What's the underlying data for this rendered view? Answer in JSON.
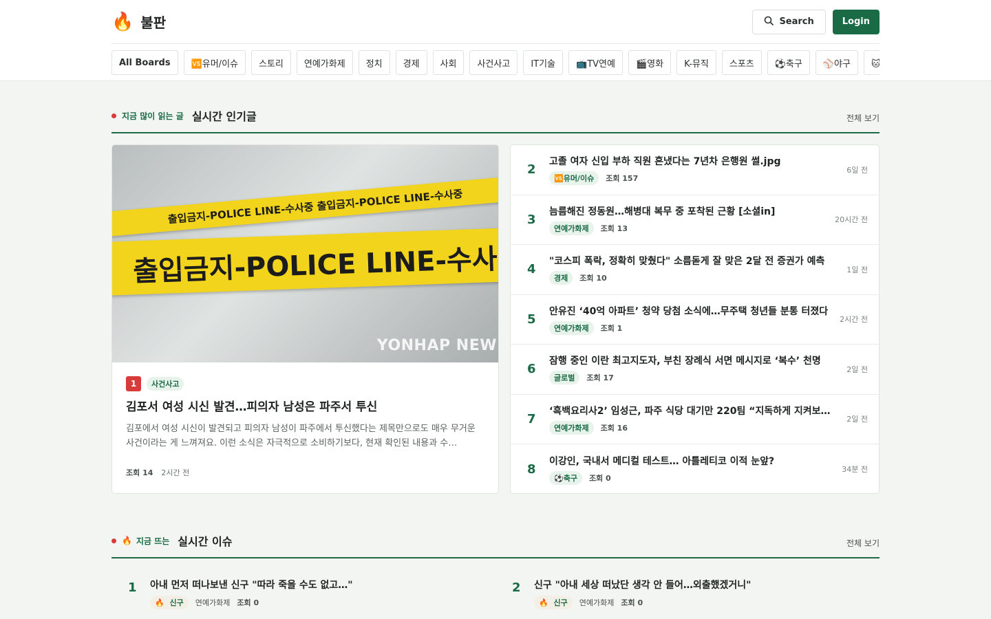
{
  "site": {
    "logo_icon": "🔥",
    "name": "불판"
  },
  "header": {
    "search_label": "Search",
    "login_label": "Login"
  },
  "boards": [
    "All Boards",
    "🆚유머/이슈",
    "스토리",
    "연예가화제",
    "정치",
    "경제",
    "사회",
    "사건사고",
    "IT기술",
    "📺TV연예",
    "🎬영화",
    "K-뮤직",
    "스포츠",
    "⚽축구",
    "⚾야구",
    "🐱반려"
  ],
  "hot": {
    "eyebrow": "지금 많이 읽는 글",
    "title": "실시간 인기글",
    "more": "전체 보기",
    "feature": {
      "rank": "1",
      "category": "사건사고",
      "title": "김포서 여성 시신 발견…피의자 남성은 파주서 투신",
      "excerpt": "김포에서 여성 시신이 발견되고 피의자 남성이 파주에서 투신했다는 제목만으로도 매우 무거운 사건이라는 게 느껴져요. 이런 소식은 자극적으로 소비하기보다, 현재 확인된 내용과 수…",
      "views": "조회 14",
      "time": "2시간 전",
      "image_text": {
        "tape_small": "출입금지-POLICE LINE-수사중   출입금지-POLICE LINE-수사중",
        "tape_large": "출입금지-POLICE LINE-수사",
        "watermark": "YONHAP NEW"
      }
    },
    "items": [
      {
        "rank": "2",
        "title": "고졸 여자 신입 부하 직원 혼냈다는 7년차 은행원 썰.jpg",
        "category": "🆚유머/이슈",
        "views": "조회 157",
        "time": "6일 전"
      },
      {
        "rank": "3",
        "title": "늠름해진 정동원…해병대 복무 중 포착된 근황 [소셜in]",
        "category": "연예가화제",
        "views": "조회 13",
        "time": "20시간 전"
      },
      {
        "rank": "4",
        "title": "\"코스피 폭락, 정확히 맞췄다\" 소름돋게 잘 맞은 2달 전 증권가 예측",
        "category": "경제",
        "views": "조회 10",
        "time": "1일 전"
      },
      {
        "rank": "5",
        "title": "안유진 ‘40억 아파트’ 청약 당첨 소식에…무주택 청년들 분통 터졌다",
        "category": "연예가화제",
        "views": "조회 1",
        "time": "2시간 전"
      },
      {
        "rank": "6",
        "title": "잠행 중인 이란 최고지도자, 부친 장례식 서면 메시지로 ‘복수’ 천명",
        "category": "글로벌",
        "views": "조회 17",
        "time": "2일 전"
      },
      {
        "rank": "7",
        "title": "‘흑백요리사2’ 임성근, 파주 식당 대기만 220팀 “지독하게 지켜보겠다”",
        "category": "연예가화제",
        "views": "조회 16",
        "time": "2일 전"
      },
      {
        "rank": "8",
        "title": "이강인, 국내서 메디컬 테스트… 아틀레티코 이적 눈앞?",
        "category": "⚽축구",
        "views": "조회 0",
        "time": "34분 전"
      }
    ]
  },
  "issues": {
    "eyebrow": "지금 뜨는",
    "eyebrow_icon": "🔥",
    "title": "실시간 이슈",
    "more": "전체 보기",
    "items": [
      {
        "rank": "1",
        "title": "아내 먼저 떠나보낸 신구 \"따라 죽을 수도 없고…\"",
        "tag": "신구",
        "category": "연예가화제",
        "views": "조회 0"
      },
      {
        "rank": "2",
        "title": "신구 \"아내 세상 떠났단 생각 안 들어…외출했겠거니\"",
        "tag": "신구",
        "category": "연예가화제",
        "views": "조회 0"
      }
    ]
  }
}
